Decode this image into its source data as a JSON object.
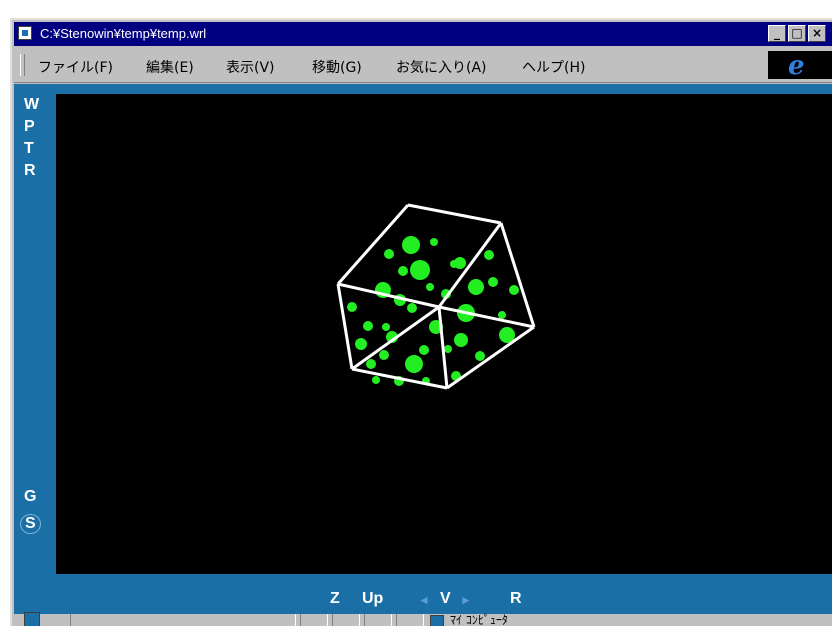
{
  "window": {
    "title": "C:¥Stenowin¥temp¥temp.wrl",
    "controls": {
      "minimize": "_",
      "maximize": "□",
      "close": "×"
    }
  },
  "menu": {
    "items": [
      {
        "label": "ファイル(F)"
      },
      {
        "label": "編集(E)"
      },
      {
        "label": "表示(V)"
      },
      {
        "label": "移動(G)"
      },
      {
        "label": "お気に入り(A)"
      },
      {
        "label": "ヘルプ(H)"
      }
    ],
    "logo_icon": "ie-logo-icon",
    "logo_glyph": "e"
  },
  "viewer": {
    "left_nav": [
      "W",
      "P",
      "T",
      "R"
    ],
    "left_nav_bottom": [
      "G",
      "S"
    ],
    "bottom_nav": [
      "Z",
      "Up",
      "V",
      "R"
    ],
    "arrow_left": "◄",
    "arrow_right": "►",
    "colors": {
      "panel": "#1a6fa6",
      "viewport": "#000000",
      "cube_edges": "#ffffff",
      "atoms": "#22ee22"
    }
  },
  "status": {
    "zone_label": "ﾏｲ ｺﾝﾋﾟｭｰﾀ"
  }
}
